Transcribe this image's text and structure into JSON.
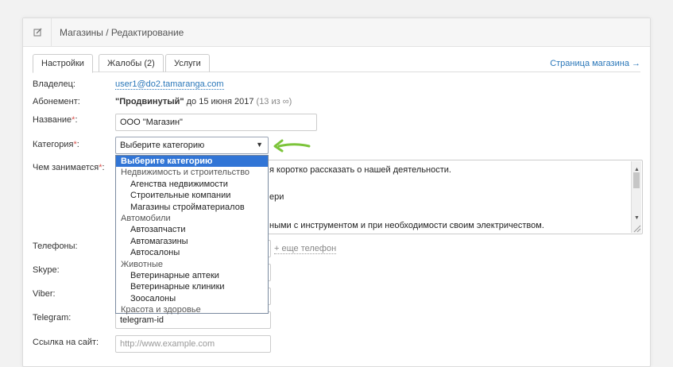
{
  "header": {
    "title": "Магазины / Редактирование",
    "icon": "edit-icon"
  },
  "tabs": [
    {
      "label": "Настройки",
      "active": true
    },
    {
      "label": "Жалобы (2)",
      "active": false
    },
    {
      "label": "Услуги",
      "active": false
    }
  ],
  "store_link": "Страница магазина →",
  "owner": {
    "label": "Владелец:",
    "value": "user1@do2.tamaranga.com"
  },
  "subscription": {
    "label": "Абонемент:",
    "plan": "\"Продвинутый\"",
    "until": " до 15 июня 2017 ",
    "extra": "(13 из ∞)"
  },
  "name": {
    "label": "Название",
    "value": "ООО \"Магазин\""
  },
  "category": {
    "label": "Категория",
    "selected": "Выберите категорию",
    "options": [
      {
        "text": "Выберите категорию",
        "kind": "selected"
      },
      {
        "text": "Недвижимость и строительство",
        "kind": "group"
      },
      {
        "text": "Агенства недвижимости",
        "kind": "child"
      },
      {
        "text": "Строительные компании",
        "kind": "child"
      },
      {
        "text": "Магазины стройматериалов",
        "kind": "child"
      },
      {
        "text": "Автомобили",
        "kind": "group"
      },
      {
        "text": "Автозапчасти",
        "kind": "child"
      },
      {
        "text": "Автомагазины",
        "kind": "child"
      },
      {
        "text": "Автосалоны",
        "kind": "child"
      },
      {
        "text": "Животные",
        "kind": "group"
      },
      {
        "text": "Ветеринарные аптеки",
        "kind": "child"
      },
      {
        "text": "Ветеринарные клиники",
        "kind": "child"
      },
      {
        "text": "Зоосалоны",
        "kind": "child"
      },
      {
        "text": "Красота и здоровье",
        "kind": "group"
      }
    ]
  },
  "about": {
    "label": "Чем занимается",
    "lines": [
      "я коротко рассказать о нашей деятельности.",
      "ери",
      "ными с инструментом и при необходимости своим электричеством."
    ]
  },
  "phones": {
    "label": "Телефоны:",
    "add": "+ еще телефон"
  },
  "skype": {
    "label": "Skype:"
  },
  "viber": {
    "label": "Viber:"
  },
  "telegram": {
    "label": "Telegram:",
    "value": "telegram-id"
  },
  "website": {
    "label": "Ссылка на сайт:",
    "placeholder": "http://www.example.com"
  },
  "colors": {
    "accent": "#2a77b9",
    "arrow": "#7cc43a",
    "selected_option": "#3175d6",
    "required": "#d9534f"
  }
}
